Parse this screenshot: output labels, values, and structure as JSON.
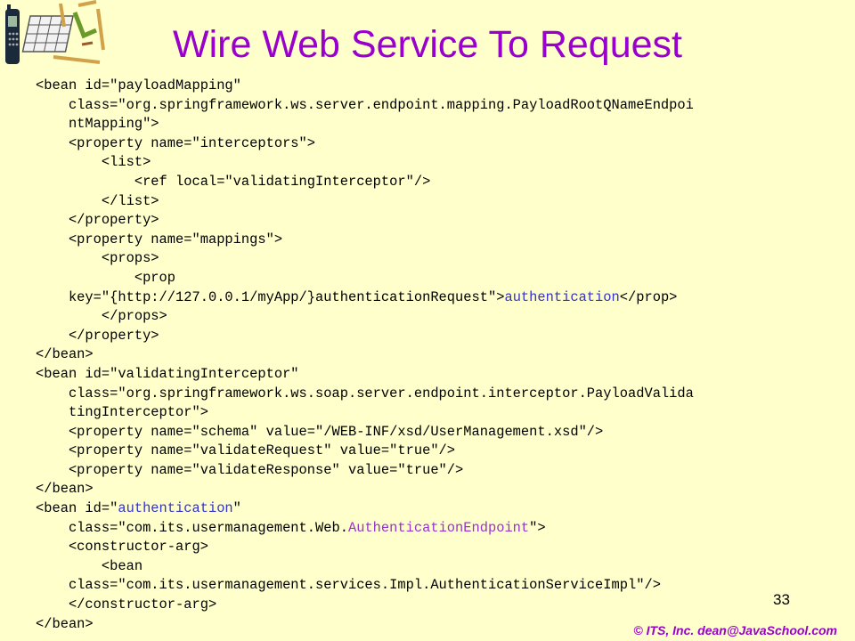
{
  "slide": {
    "title": "Wire Web Service To Request",
    "page_number": "33",
    "copyright": "© ITS, Inc. dean@JavaSchool.com",
    "colors": {
      "background": "#FFFFCC",
      "title": "#9900CC",
      "highlight_blue": "#3333CC",
      "highlight_purple": "#9933CC"
    }
  },
  "code": {
    "l1": "<bean id=\"payloadMapping\"",
    "l2": "    class=\"org.springframework.ws.server.endpoint.mapping.PayloadRootQNameEndpoi",
    "l3": "    ntMapping\">",
    "l4": "    <property name=\"interceptors\">",
    "l5": "        <list>",
    "l6": "            <ref local=\"validatingInterceptor\"/>",
    "l7": "        </list>",
    "l8": "    </property>",
    "l9": "    <property name=\"mappings\">",
    "l10": "        <props>",
    "l11": "            <prop",
    "l12a": "    key=\"{http://127.0.0.1/myApp/}authenticationRequest\">",
    "l12b": "authentication",
    "l12c": "</prop>",
    "l13": "        </props>",
    "l14": "    </property>",
    "l15": "</bean>",
    "l16": "<bean id=\"validatingInterceptor\"",
    "l17": "    class=\"org.springframework.ws.soap.server.endpoint.interceptor.PayloadValida",
    "l18": "    tingInterceptor\">",
    "l19": "    <property name=\"schema\" value=\"/WEB-INF/xsd/UserManagement.xsd\"/>",
    "l20": "    <property name=\"validateRequest\" value=\"true\"/>",
    "l21": "    <property name=\"validateResponse\" value=\"true\"/>",
    "l22": "</bean>",
    "l23a": "<bean id=\"",
    "l23b": "authentication",
    "l23c": "\"",
    "l24a": "    class=\"com.its.usermanagement.Web.",
    "l24b": "AuthenticationEndpoint",
    "l24c": "\">",
    "l25": "    <constructor-arg>",
    "l26": "        <bean",
    "l27": "    class=\"com.its.usermanagement.services.Impl.AuthenticationServiceImpl\"/>",
    "l28": "    </constructor-arg>",
    "l29": "</bean>"
  },
  "logo": {
    "icon": "phone-and-grid-logo-icon"
  }
}
